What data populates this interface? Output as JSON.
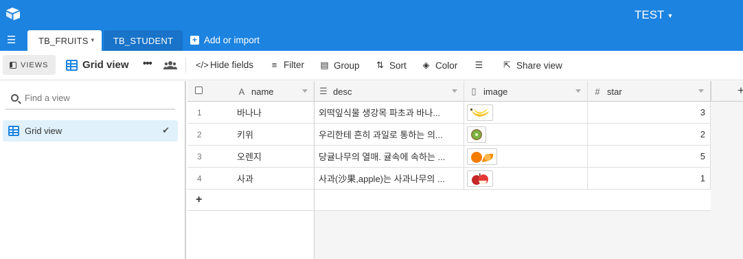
{
  "app": {
    "base_name": "TEST",
    "colors": {
      "accent": "#1c83e0",
      "tab_inactive": "#1973c8",
      "selected_view": "#e1f1fb"
    }
  },
  "tabs": {
    "active": "TB_FRUITS",
    "other": "TB_STUDENT",
    "add_label": "Add or import"
  },
  "toolbar": {
    "views_label": "VIEWS",
    "view_name": "Grid view",
    "hide_fields": "Hide fields",
    "filter": "Filter",
    "group": "Group",
    "sort": "Sort",
    "color": "Color",
    "share_view": "Share view"
  },
  "sidebar": {
    "search_placeholder": "Find a view",
    "views": [
      {
        "label": "Grid view",
        "selected": true,
        "icon": "grid-icon"
      }
    ]
  },
  "table": {
    "columns": [
      {
        "label": "name",
        "icon": "text-icon"
      },
      {
        "label": "desc",
        "icon": "long-text-icon"
      },
      {
        "label": "image",
        "icon": "attachment-icon"
      },
      {
        "label": "star",
        "icon": "number-icon"
      }
    ],
    "rows": [
      {
        "num": "1",
        "name": "바나나",
        "desc": "외떡잎식물 생강목 파초과 바나...",
        "image": "banana",
        "star": "3"
      },
      {
        "num": "2",
        "name": "키위",
        "desc": "우리한테 흔히 과일로 통하는 의...",
        "image": "kiwi",
        "star": "2"
      },
      {
        "num": "3",
        "name": "오렌지",
        "desc": "당귤나무의 열매. 귤속에 속하는 ...",
        "image": "orange",
        "star": "5"
      },
      {
        "num": "4",
        "name": "사과",
        "desc": "사과(沙果,apple)는 사과나무의 ...",
        "image": "apple",
        "star": "1"
      }
    ]
  }
}
